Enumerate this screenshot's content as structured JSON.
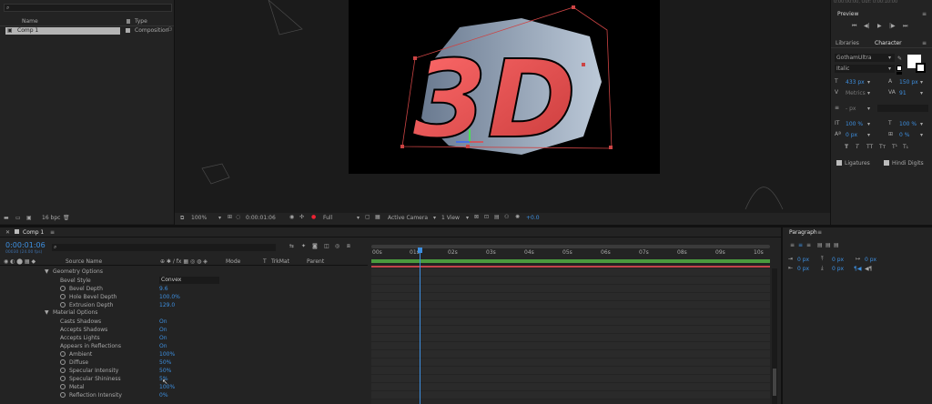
{
  "project": {
    "search_placeholder": "",
    "col_name": "Name",
    "col_type": "Type",
    "item_name": "Comp 1",
    "item_type": "Composition",
    "bpc": "16 bpc"
  },
  "viewer": {
    "headline": "3D",
    "zoom": "100%",
    "timecode": "0:00:01:06",
    "resolution": "Full",
    "camera": "Active Camera",
    "views": "1 View",
    "exposure": "+0.0"
  },
  "right_panel": {
    "header_timecode": "0:00:00:00, Out: 0:00:10:00",
    "preview_title": "Preview",
    "tab_libraries": "Libraries",
    "tab_character": "Character",
    "font_family": "GothamUltra",
    "font_style": "Italic",
    "font_size": "433 px",
    "leading": "150 px",
    "kerning": "Metrics",
    "tracking": "91",
    "stroke_width": "- px",
    "vert_scale": "100 %",
    "horiz_scale": "100 %",
    "baseline_shift": "0 px",
    "tsume": "0 %",
    "style_buttons": [
      "T",
      "T",
      "TT",
      "Tт",
      "T¹",
      "T₁"
    ],
    "ligatures": "Ligatures",
    "hindi_digits": "Hindi Digits"
  },
  "timeline": {
    "tab_label": "Comp 1",
    "current_time": "0:00:01:06",
    "frames": "00030 (24.00 fps)",
    "col_source_name": "Source Name",
    "col_mode": "Mode",
    "col_t": "T",
    "col_trkmat": "TrkMat",
    "col_parent": "Parent",
    "ruler_ticks": [
      "00s",
      "01s",
      "02s",
      "03s",
      "04s",
      "05s",
      "06s",
      "07s",
      "08s",
      "09s",
      "10s"
    ],
    "properties": [
      {
        "label": "Geometry Options",
        "value": "",
        "level": 1,
        "twirl": true,
        "stopwatch": false
      },
      {
        "label": "Bevel Style",
        "value": "Convex",
        "level": 2,
        "twirl": false,
        "stopwatch": false,
        "dropdown": true
      },
      {
        "label": "Bevel Depth",
        "value": "9.6",
        "level": 2,
        "twirl": false,
        "stopwatch": true
      },
      {
        "label": "Hole Bevel Depth",
        "value": "100.0%",
        "level": 2,
        "twirl": false,
        "stopwatch": true
      },
      {
        "label": "Extrusion Depth",
        "value": "129.0",
        "level": 2,
        "twirl": false,
        "stopwatch": true
      },
      {
        "label": "Material Options",
        "value": "",
        "level": 1,
        "twirl": true,
        "stopwatch": false
      },
      {
        "label": "Casts Shadows",
        "value": "On",
        "level": 2,
        "twirl": false,
        "stopwatch": false
      },
      {
        "label": "Accepts Shadows",
        "value": "On",
        "level": 2,
        "twirl": false,
        "stopwatch": false
      },
      {
        "label": "Accepts Lights",
        "value": "On",
        "level": 2,
        "twirl": false,
        "stopwatch": false
      },
      {
        "label": "Appears in Reflections",
        "value": "On",
        "level": 2,
        "twirl": false,
        "stopwatch": false
      },
      {
        "label": "Ambient",
        "value": "100%",
        "level": 2,
        "twirl": false,
        "stopwatch": true
      },
      {
        "label": "Diffuse",
        "value": "50%",
        "level": 2,
        "twirl": false,
        "stopwatch": true
      },
      {
        "label": "Specular Intensity",
        "value": "50%",
        "level": 2,
        "twirl": false,
        "stopwatch": true
      },
      {
        "label": "Specular Shininess",
        "value": "5%",
        "level": 2,
        "twirl": false,
        "stopwatch": true
      },
      {
        "label": "Metal",
        "value": "100%",
        "level": 2,
        "twirl": false,
        "stopwatch": true
      },
      {
        "label": "Reflection Intensity",
        "value": "0%",
        "level": 2,
        "twirl": false,
        "stopwatch": true
      }
    ]
  },
  "paragraph": {
    "title": "Paragraph",
    "indent_left": "0 px",
    "indent_right": "0 px",
    "indent_first": "0 px",
    "space_before": "0 px",
    "space_after": "0 px"
  },
  "colors": {
    "accent": "#3d8fe0",
    "red_text": "#ff5a5a",
    "work_area": "#4a9a3e"
  }
}
